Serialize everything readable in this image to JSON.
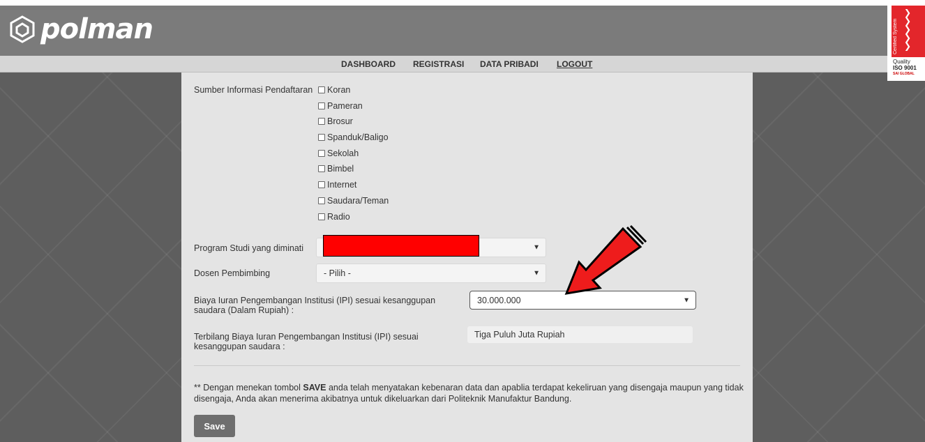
{
  "brand": {
    "name": "polman",
    "iso": {
      "vertical": "Certified System",
      "quality": "Quality",
      "standard": "ISO 9001",
      "issuer": "SAI GLOBAL"
    }
  },
  "nav": [
    "DASHBOARD",
    "REGISTRASI",
    "DATA PRIBADI",
    "LOGOUT"
  ],
  "form": {
    "sumber_label": "Sumber Informasi Pendaftaran",
    "sumber_options": [
      "Koran",
      "Pameran",
      "Brosur",
      "Spanduk/Baligo",
      "Sekolah",
      "Bimbel",
      "Internet",
      "Saudara/Teman",
      "Radio"
    ],
    "prodi_label": "Program Studi yang diminati",
    "dosen_label": "Dosen Pembimbing",
    "dosen_value": "- Pilih -",
    "ipi_label_1": "Biaya Iuran Pengembangan Institusi (IPI) sesuai kesanggupan",
    "ipi_label_2": "saudara (Dalam Rupiah) :",
    "ipi_value": "30.000.000",
    "terbilang_label_1": "Terbilang Biaya Iuran Pengembangan Institusi (IPI) sesuai",
    "terbilang_label_2": "kesanggupan saudara :",
    "terbilang_value": "Tiga Puluh Juta Rupiah"
  },
  "note": {
    "prefix": "** Dengan menekan tombol ",
    "bold": "SAVE",
    "suffix": " anda telah menyatakan kebenaran data dan apablia terdapat kekeliruan yang disengaja maupun yang tidak disengaja, Anda akan menerima akibatnya untuk dikeluarkan dari Politeknik Manufaktur Bandung."
  },
  "save_label": "Save",
  "colors": {
    "redaction": "#ff0000",
    "arrow": "#ee1c1c",
    "header": "#7b7b7b"
  }
}
